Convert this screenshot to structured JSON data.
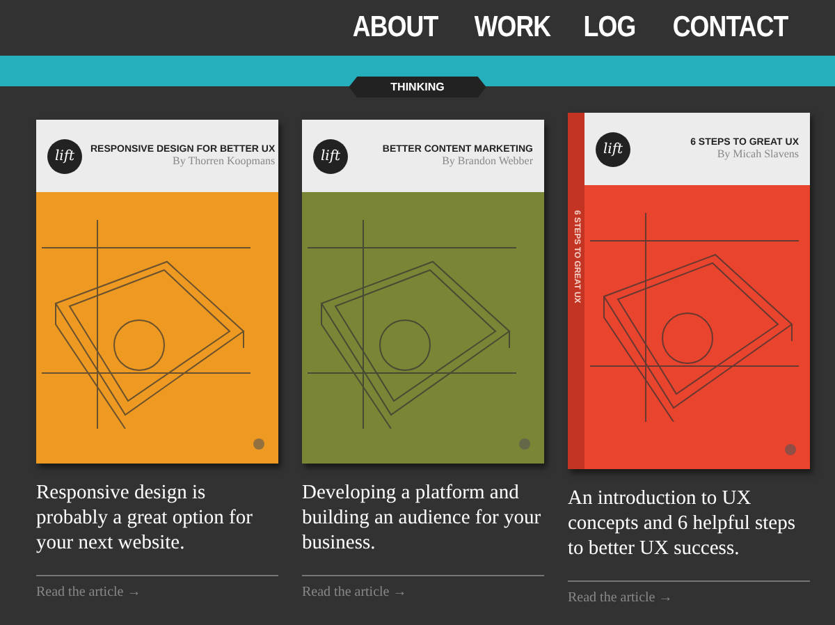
{
  "nav": {
    "items": [
      "ABOUT",
      "WORK",
      "LOG",
      "CONTACT"
    ]
  },
  "section_tag": "THINKING",
  "articles": [
    {
      "color": "#ee9a22",
      "logo": "lift",
      "title": "RESPONSIVE DESIGN FOR BETTER UX",
      "author": "By Thorren Koopmans",
      "summary": "Responsive design is probably a great option for your next website.",
      "link": "Read the article →"
    },
    {
      "color": "#7a8535",
      "logo": "lift",
      "title": "BETTER CONTENT MARKETING",
      "author": "By Brandon Webber",
      "summary": "Developing a platform and building an audience for your business.",
      "link": "Read the article →"
    },
    {
      "color": "#e8442e",
      "logo": "lift",
      "title": "6 STEPS TO GREAT UX",
      "author": "By Micah Slavens",
      "spine_title": "6 STEPS TO GREAT UX",
      "summary": "An introduction to UX concepts and 6 helpful steps to better UX success.",
      "link": "Read the article →"
    }
  ]
}
